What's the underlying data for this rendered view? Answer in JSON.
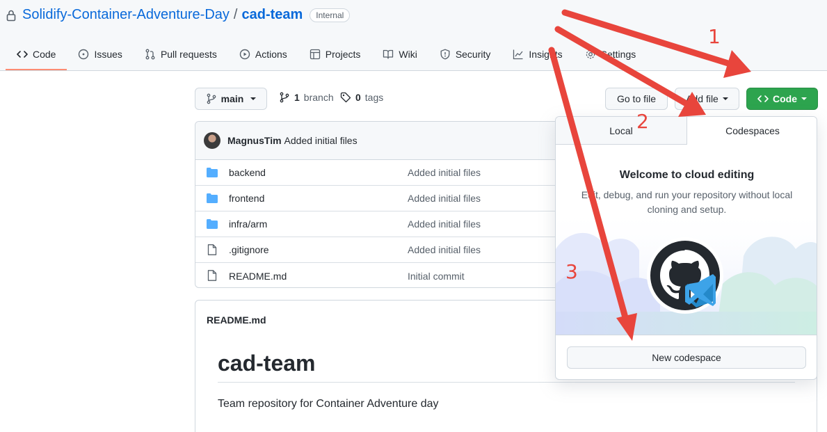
{
  "repo": {
    "owner": "Solidify-Container-Adventure-Day",
    "separator": "/",
    "name": "cad-team",
    "visibility": "Internal"
  },
  "tabs": [
    {
      "label": "Code",
      "icon": "code-icon",
      "active": true
    },
    {
      "label": "Issues",
      "icon": "issue-icon"
    },
    {
      "label": "Pull requests",
      "icon": "pull-request-icon"
    },
    {
      "label": "Actions",
      "icon": "play-icon"
    },
    {
      "label": "Projects",
      "icon": "table-icon"
    },
    {
      "label": "Wiki",
      "icon": "book-icon"
    },
    {
      "label": "Security",
      "icon": "shield-icon"
    },
    {
      "label": "Insights",
      "icon": "graph-icon"
    },
    {
      "label": "Settings",
      "icon": "gear-icon"
    }
  ],
  "toolbar": {
    "branch": "main",
    "branch_count": "1",
    "branch_label": "branch",
    "tag_count": "0",
    "tag_label": "tags",
    "go_to_file": "Go to file",
    "add_file": "Add file",
    "code": "Code"
  },
  "commit": {
    "author": "MagnusTim",
    "message": "Added initial files"
  },
  "files": [
    {
      "name": "backend",
      "type": "folder",
      "message": "Added initial files"
    },
    {
      "name": "frontend",
      "type": "folder",
      "message": "Added initial files"
    },
    {
      "name": "infra/arm",
      "type": "folder",
      "message": "Added initial files"
    },
    {
      "name": ".gitignore",
      "type": "file",
      "message": "Added initial files"
    },
    {
      "name": "README.md",
      "type": "file",
      "message": "Initial commit"
    }
  ],
  "readme": {
    "filename": "README.md",
    "title": "cad-team",
    "body": "Team repository for Container Adventure day"
  },
  "dropdown": {
    "tab_local": "Local",
    "tab_codespaces": "Codespaces",
    "welcome_title": "Welcome to cloud editing",
    "welcome_desc": "Edit, debug, and run your repository without local cloning and setup.",
    "new_codespace": "New codespace"
  },
  "annotations": {
    "step1": "1",
    "step2": "2",
    "step3": "3",
    "arrow_color": "#e8453c"
  },
  "colors": {
    "link": "#0969da",
    "primary_button": "#2da44e",
    "folder": "#54aeff",
    "active_tab_underline": "#fd8c73"
  }
}
